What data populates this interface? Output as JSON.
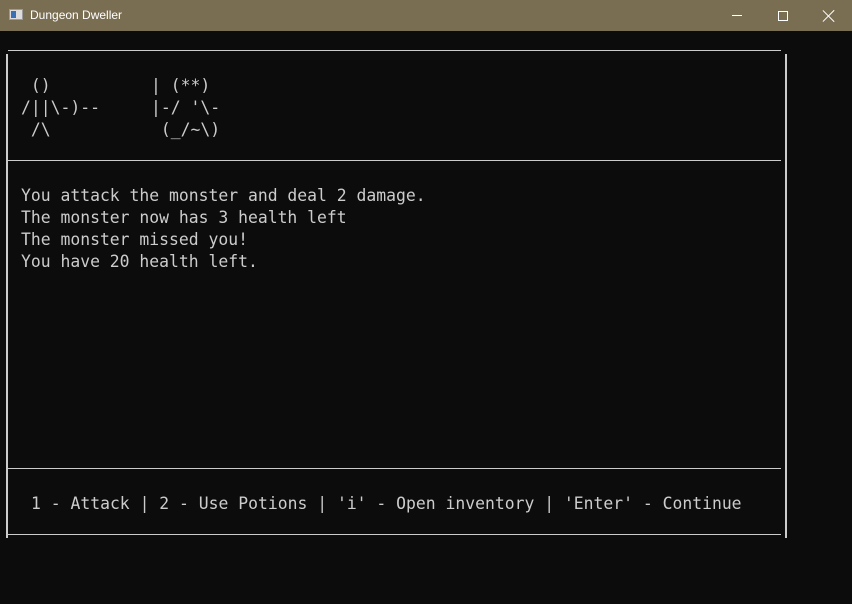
{
  "window": {
    "title": "Dungeon Dweller",
    "controls": {
      "minimize": "minimize",
      "maximize": "maximize",
      "close": "close"
    }
  },
  "scene": {
    "player_art": " ()\n/||\\-)--\n /\\",
    "monster_art": "| (**)\n|-/ '\\-\n (_/~\\)"
  },
  "log": [
    "You attack the monster and deal 2 damage.",
    "The monster now has 3 health left",
    "The monster missed you!",
    "You have 20 health left."
  ],
  "menu": {
    "options": [
      "1 - Attack ",
      " 2 - Use Potions ",
      " 'i' - Open inventory ",
      " 'Enter' - Continue"
    ],
    "separator": "|"
  },
  "colors": {
    "titlebar": "#7a6e52",
    "console_bg": "#0c0c0c",
    "console_fg": "#cccccc"
  }
}
